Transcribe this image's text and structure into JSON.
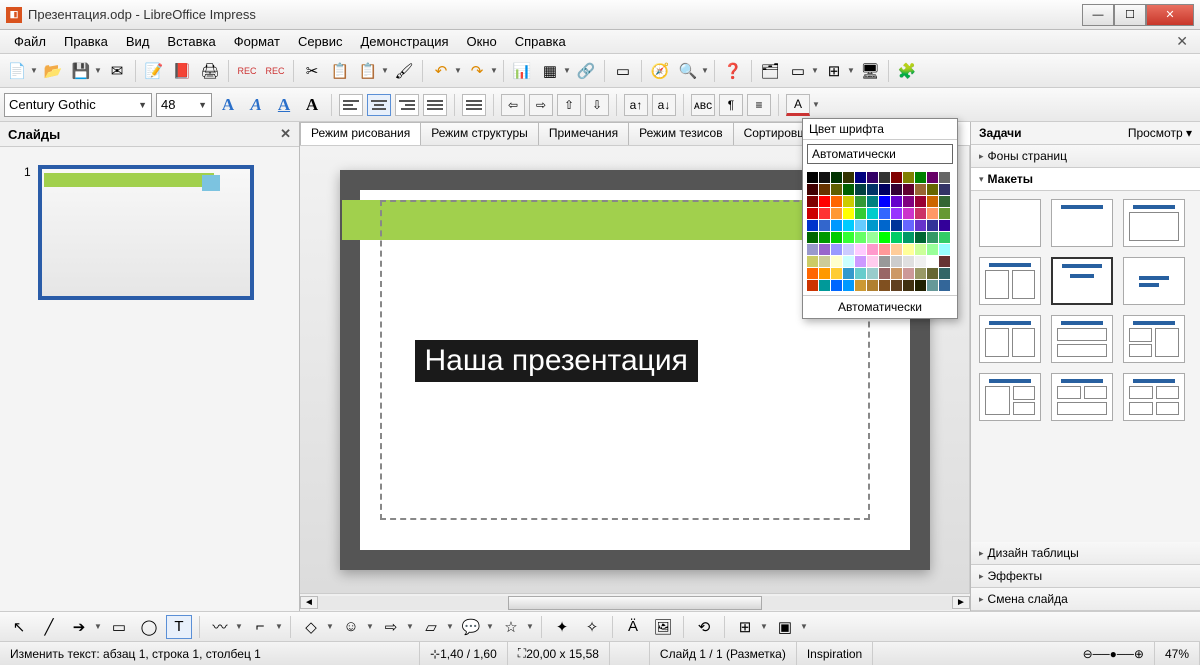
{
  "window": {
    "title": "Презентация.odp - LibreOffice Impress"
  },
  "menu": {
    "file": "Файл",
    "edit": "Правка",
    "view": "Вид",
    "insert": "Вставка",
    "format": "Формат",
    "tools": "Сервис",
    "slideshow": "Демонстрация",
    "window": "Окно",
    "help": "Справка"
  },
  "format_toolbar": {
    "font_name": "Century Gothic",
    "font_size": "48"
  },
  "panels": {
    "slides_title": "Слайды",
    "tasks_title": "Задачи",
    "tasks_view": "Просмотр",
    "page_backgrounds": "Фоны страниц",
    "layouts": "Макеты",
    "table_design": "Дизайн таблицы",
    "effects": "Эффекты",
    "slide_transition": "Смена слайда"
  },
  "view_tabs": {
    "drawing": "Режим рисования",
    "outline": "Режим структуры",
    "notes": "Примечания",
    "handout": "Режим тезисов",
    "sorter": "Сортировщик слайд"
  },
  "slide": {
    "title_text": "Наша презентация",
    "number": "1"
  },
  "color_popup": {
    "header": "Цвет шрифта",
    "auto_button": "Автоматически",
    "auto_label": "Автоматически",
    "colors": [
      "#000000",
      "#111111",
      "#003300",
      "#333300",
      "#000080",
      "#330066",
      "#333333",
      "#800000",
      "#808000",
      "#008000",
      "#660066",
      "#666666",
      "#400000",
      "#663300",
      "#606000",
      "#006000",
      "#004040",
      "#003366",
      "#000060",
      "#330033",
      "#600030",
      "#996633",
      "#666600",
      "#333366",
      "#800000",
      "#ff0000",
      "#ff6600",
      "#cccc00",
      "#339933",
      "#008080",
      "#0000ff",
      "#6600cc",
      "#800080",
      "#990033",
      "#cc6600",
      "#336633",
      "#cc0000",
      "#ff3333",
      "#ff9933",
      "#ffff00",
      "#33cc33",
      "#00cccc",
      "#3366ff",
      "#9933ff",
      "#cc33cc",
      "#cc3366",
      "#ff9966",
      "#669933",
      "#0033cc",
      "#3366cc",
      "#0099ff",
      "#00ccff",
      "#66ccff",
      "#0099cc",
      "#0066cc",
      "#003399",
      "#6666ff",
      "#6633cc",
      "#333399",
      "#330099",
      "#006600",
      "#009900",
      "#00cc00",
      "#33ff33",
      "#66ff66",
      "#99ff99",
      "#00ff00",
      "#00cc66",
      "#009966",
      "#006633",
      "#339966",
      "#33cc66",
      "#9999cc",
      "#9966cc",
      "#9999ff",
      "#ccccff",
      "#ffccff",
      "#ff99cc",
      "#ff9999",
      "#ffcc99",
      "#ffff99",
      "#ccff99",
      "#99ff99",
      "#99ffff",
      "#cccc66",
      "#cccc99",
      "#ffffcc",
      "#ccffff",
      "#cc99ff",
      "#ffccee",
      "#999999",
      "#cccccc",
      "#e0e0e0",
      "#f0f0f0",
      "#ffffff",
      "#663333",
      "#ff6600",
      "#ff9900",
      "#ffcc33",
      "#3399cc",
      "#66cccc",
      "#99cccc",
      "#996666",
      "#cc9966",
      "#cc9999",
      "#999966",
      "#666633",
      "#336666",
      "#cc3300",
      "#009999",
      "#0066ff",
      "#0099ff",
      "#cc9933",
      "#b08030",
      "#805020",
      "#604020",
      "#403010",
      "#202000",
      "#669999",
      "#336699"
    ]
  },
  "statusbar": {
    "edit_text": "Изменить текст: абзац 1, строка 1, столбец 1",
    "coords": "1,40 / 1,60",
    "size": "20,00 x 15,58",
    "slide_info": "Слайд 1 / 1 (Разметка)",
    "template": "Inspiration",
    "zoom": "47%"
  }
}
